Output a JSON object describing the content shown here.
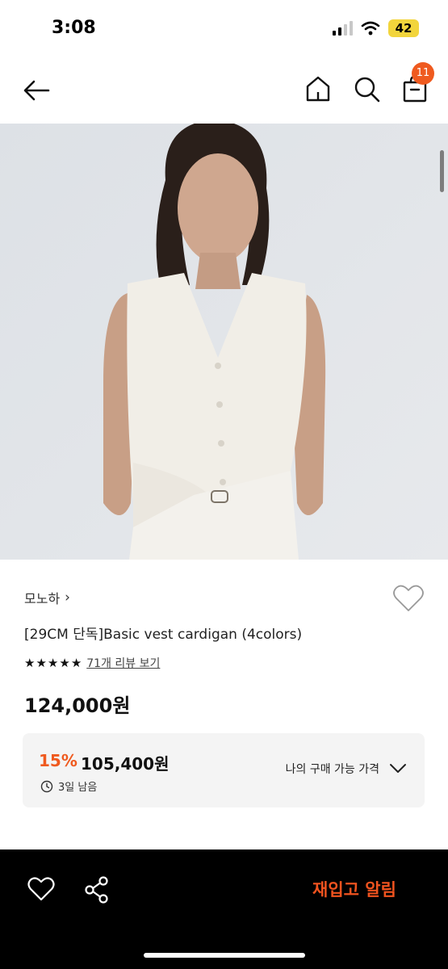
{
  "status_bar": {
    "time": "3:08",
    "battery": "42"
  },
  "nav": {
    "cart_count": "11"
  },
  "product": {
    "brand": "모노하",
    "brand_chevron": "›",
    "title": "[29CM 단독]Basic vest cardigan (4colors)",
    "rating_stars": 5,
    "review_link": "71개 리뷰 보기",
    "price": "124,000원"
  },
  "coupon": {
    "discount_rate": "15%",
    "discount_price": "105,400원",
    "time_left": "3일 남음",
    "my_price_label": "나의 구매 가능 가격"
  },
  "bottom_bar": {
    "restock_label": "재입고 알림"
  },
  "colors": {
    "accent": "#ef5a1f",
    "restock": "#f0531f"
  }
}
